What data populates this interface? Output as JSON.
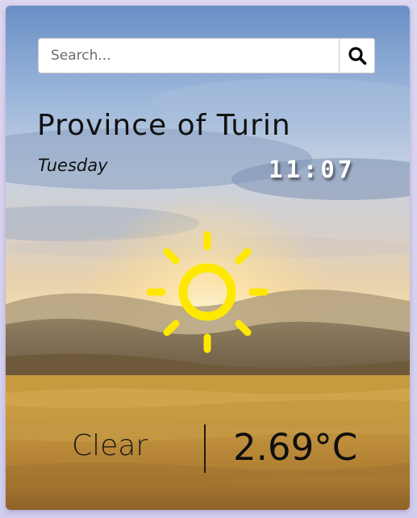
{
  "search": {
    "placeholder": "Search...",
    "value": "",
    "button_icon": "search-icon"
  },
  "location": {
    "city": "Province of Turin"
  },
  "datetime": {
    "day": "Tuesday",
    "time": "11:07"
  },
  "weather": {
    "icon": "sun-icon",
    "condition": "Clear",
    "temperature": "2.69°C"
  },
  "colors": {
    "sun": "#ffe800",
    "sky_top": "#6f93c8",
    "field": "#c89a3a"
  }
}
